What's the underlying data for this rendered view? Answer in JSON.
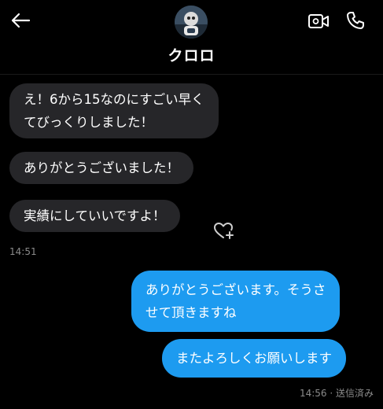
{
  "header": {
    "back_icon": "arrow-left-icon",
    "contact_name": "クロロ",
    "video_icon": "video-camera-icon",
    "call_icon": "phone-icon"
  },
  "messages": {
    "incoming": [
      {
        "lines": [
          "え！6から15なのにすごい早く",
          "てびっくりしました！"
        ]
      },
      {
        "lines": [
          "ありがとうございました！"
        ]
      },
      {
        "lines": [
          "実績にしていいですよ！"
        ]
      }
    ],
    "incoming_time": "14:51",
    "react_icon": "heart-plus-icon",
    "outgoing": [
      {
        "lines": [
          "ありがとうございます。そうさ",
          "せて頂きますね"
        ]
      },
      {
        "lines": [
          "またよろしくお願いします"
        ]
      }
    ],
    "outgoing_status": "14:56 · 送信済み"
  },
  "colors": {
    "background": "#000000",
    "incoming_bubble": "#262629",
    "outgoing_bubble": "#1d9bf0",
    "meta_text": "#8b8b8b"
  }
}
